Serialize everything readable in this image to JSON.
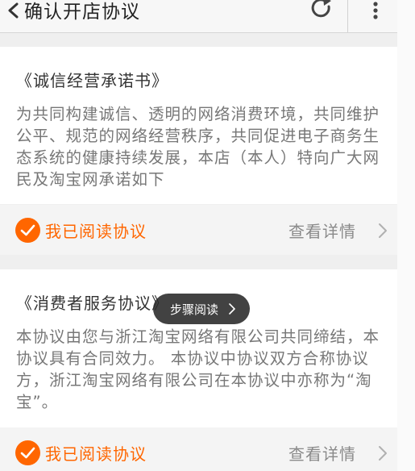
{
  "header": {
    "title": "确认开店协议",
    "back_icon": "chevron-left-icon",
    "refresh_icon": "refresh-icon",
    "more_icon": "more-vertical-icon"
  },
  "agreements": [
    {
      "title": "《诚信经营承诺书》",
      "body": "为共同构建诚信、透明的网络消费环境，共同维护公平、规范的网络经营秩序，共同促进电子商务生态系统的健康持续发展，本店（本人）特向广大网民及淘宝网承诺如下",
      "agree_label": "我已阅读协议",
      "detail_label": "查看详情"
    },
    {
      "title": "《消费者服务协议》",
      "body": "本协议由您与浙江淘宝网络有限公司共同缔结，本协议具有合同效力。 本协议中协议双方合称协议方，浙江淘宝网络有限公司在本协议中亦称为“淘宝”。",
      "agree_label": "我已阅读协议",
      "detail_label": "查看详情"
    }
  ],
  "toast": {
    "label": "步骤阅读"
  },
  "colors": {
    "accent": "#ff6600",
    "background": "#efefef",
    "card": "#ffffff"
  }
}
